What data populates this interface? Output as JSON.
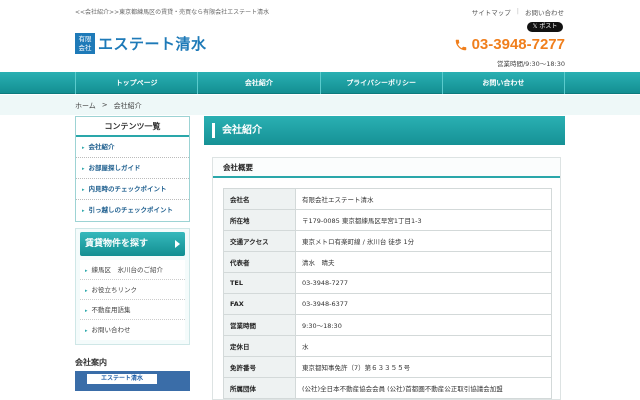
{
  "header": {
    "breadcrumb_text": "<<会社紹介>>東京都練馬区の賃貸・売買なら有限会社エステート清水",
    "links": [
      "サイトマップ",
      "お問い合わせ"
    ],
    "share_label": "𝕏 ポスト",
    "logo_mark_line1": "有限",
    "logo_mark_line2": "会社",
    "logo_name": "エステート清水",
    "phone": "03-3948-7277",
    "hours": "営業時間/9:30～18:30"
  },
  "nav": {
    "items": [
      "トップページ",
      "会社紹介",
      "プライバシーポリシー",
      "お問い合わせ"
    ]
  },
  "breadcrumb": {
    "home": "ホーム",
    "separator": ">",
    "current": "会社紹介"
  },
  "sidebar": {
    "contents_title": "コンテンツ一覧",
    "menu": [
      "会社紹介",
      "お部屋探しガイド",
      "内見時のチェックポイント",
      "引っ越しのチェックポイント"
    ],
    "search_button": "賃貸物件を探す",
    "links": [
      "練馬区　氷川台のご紹介",
      "お役立ちリンク",
      "不動産用語集",
      "お問い合わせ"
    ],
    "company_heading": "会社案内",
    "photo_sign": "エステート清水"
  },
  "main": {
    "page_title": "会社紹介",
    "section_title": "会社概要",
    "rows": [
      {
        "label": "会社名",
        "value": "有限会社エステート清水"
      },
      {
        "label": "所在地",
        "value": "〒179-0085 東京都練馬区早宮1丁目1-3"
      },
      {
        "label": "交通アクセス",
        "value": "東京メトロ有楽町線 / 氷川台 徒歩 1分"
      },
      {
        "label": "代表者",
        "value": "清水　晴夫"
      },
      {
        "label": "TEL",
        "value": "03-3948-7277"
      },
      {
        "label": "FAX",
        "value": "03-3948-6377"
      },
      {
        "label": "営業時間",
        "value": "9:30～18:30"
      },
      {
        "label": "定休日",
        "value": "水"
      },
      {
        "label": "免許番号",
        "value": "東京都知事免許（7）第６３３５５号"
      },
      {
        "label": "所属団体",
        "value": "(公社)全日本不動産協会会員 (公社)首都圏不動産公正取引協議会加盟"
      }
    ]
  },
  "colors": {
    "teal": "#2aa7aa",
    "brand_blue": "#1e7ab8",
    "phone_orange": "#f07f1d"
  }
}
